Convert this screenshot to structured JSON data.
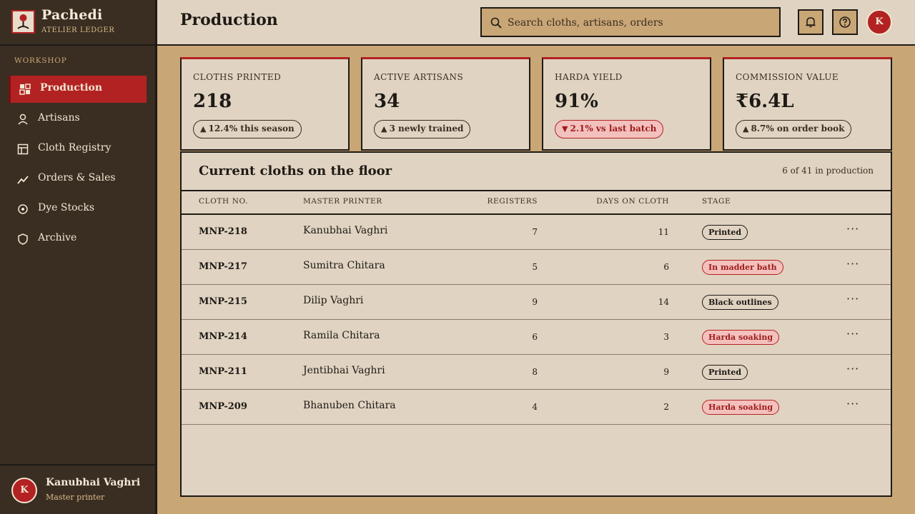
{
  "brand": {
    "name": "Pachedi",
    "subtitle": "ATELIER LEDGER"
  },
  "sidebar": {
    "section": "WORKSHOP",
    "items": [
      {
        "label": "Production",
        "icon": "dashboard-icon",
        "active": true
      },
      {
        "label": "Artisans",
        "icon": "person-icon",
        "active": false
      },
      {
        "label": "Cloth Registry",
        "icon": "layout-icon",
        "active": false
      },
      {
        "label": "Orders & Sales",
        "icon": "trend-icon",
        "active": false
      },
      {
        "label": "Dye Stocks",
        "icon": "target-icon",
        "active": false
      },
      {
        "label": "Archive",
        "icon": "shield-icon",
        "active": false
      }
    ],
    "user": {
      "initial": "K",
      "name": "Kanubhai Vaghri",
      "role": "Master printer"
    }
  },
  "header": {
    "title": "Production",
    "search_placeholder": "Search cloths, artisans, orders",
    "avatar_initial": "K"
  },
  "stats": [
    {
      "label": "CLOTHS PRINTED",
      "value": "218",
      "delta": "12.4% this season",
      "direction": "up"
    },
    {
      "label": "ACTIVE ARTISANS",
      "value": "34",
      "delta": "3 newly trained",
      "direction": "up"
    },
    {
      "label": "HARDA YIELD",
      "value": "91%",
      "delta": "2.1% vs last batch",
      "direction": "down"
    },
    {
      "label": "COMMISSION VALUE",
      "value": "₹6.4L",
      "delta": "8.7% on order book",
      "direction": "up"
    }
  ],
  "table": {
    "title": "Current cloths on the floor",
    "count": "6 of 41 in production",
    "columns": {
      "no": "CLOTH NO.",
      "master": "MASTER PRINTER",
      "registers": "REGISTERS",
      "days": "DAYS ON CLOTH",
      "stage": "STAGE"
    },
    "rows": [
      {
        "no": "MNP-218",
        "master": "Kanubhai Vaghri",
        "registers": "7",
        "days": "11",
        "stage": "Printed",
        "alert": false
      },
      {
        "no": "MNP-217",
        "master": "Sumitra Chitara",
        "registers": "5",
        "days": "6",
        "stage": "In madder bath",
        "alert": true
      },
      {
        "no": "MNP-215",
        "master": "Dilip Vaghri",
        "registers": "9",
        "days": "14",
        "stage": "Black outlines",
        "alert": false
      },
      {
        "no": "MNP-214",
        "master": "Ramila Chitara",
        "registers": "6",
        "days": "3",
        "stage": "Harda soaking",
        "alert": true
      },
      {
        "no": "MNP-211",
        "master": "Jentibhai Vaghri",
        "registers": "8",
        "days": "9",
        "stage": "Printed",
        "alert": false
      },
      {
        "no": "MNP-209",
        "master": "Bhanuben Chitara",
        "registers": "4",
        "days": "2",
        "stage": "Harda soaking",
        "alert": true
      }
    ],
    "row_menu": "···"
  },
  "colors": {
    "accent": "#b32222",
    "sidebar": "#3a2e22",
    "surface": "#e0d3c1",
    "background": "#c9a676"
  }
}
